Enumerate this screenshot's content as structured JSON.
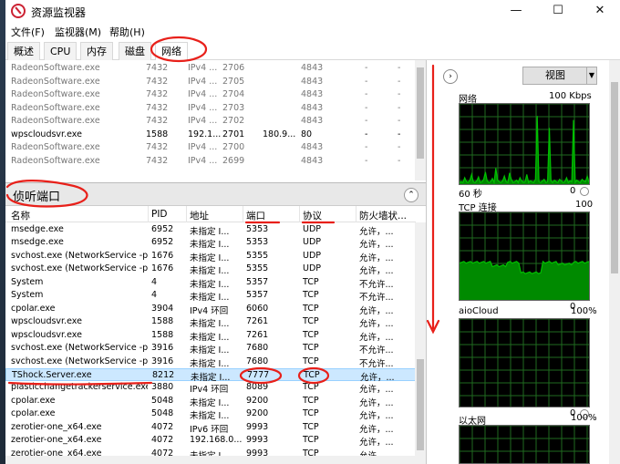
{
  "window": {
    "title": "资源监视器",
    "minimize_glyph": "—",
    "maximize_glyph": "☐",
    "close_glyph": "✕"
  },
  "menu": [
    "文件(F)",
    "监视器(M)",
    "帮助(H)"
  ],
  "tabs": [
    {
      "label": "概述",
      "active": false
    },
    {
      "label": "CPU",
      "active": false
    },
    {
      "label": "内存",
      "active": false
    },
    {
      "label": "磁盘",
      "active": false
    },
    {
      "label": "网络",
      "active": true
    }
  ],
  "upper_rows": [
    [
      "RadeonSoftware.exe",
      "7432",
      "IPv4 ...",
      "2706",
      "",
      "4843",
      "-",
      "-"
    ],
    [
      "RadeonSoftware.exe",
      "7432",
      "IPv4 ...",
      "2705",
      "",
      "4843",
      "-",
      "-"
    ],
    [
      "RadeonSoftware.exe",
      "7432",
      "IPv4 ...",
      "2704",
      "",
      "4843",
      "-",
      "-"
    ],
    [
      "RadeonSoftware.exe",
      "7432",
      "IPv4 ...",
      "2703",
      "",
      "4843",
      "-",
      "-"
    ],
    [
      "RadeonSoftware.exe",
      "7432",
      "IPv4 ...",
      "2702",
      "",
      "4843",
      "-",
      "-"
    ],
    [
      "wpscloudsvr.exe",
      "1588",
      "192.1...",
      "2701",
      "180.9...",
      "80",
      "-",
      "-"
    ],
    [
      "RadeonSoftware.exe",
      "7432",
      "IPv4 ...",
      "2700",
      "",
      "4843",
      "-",
      "-"
    ],
    [
      "RadeonSoftware.exe",
      "7432",
      "IPv4 ...",
      "2699",
      "",
      "4843",
      "-",
      "-"
    ]
  ],
  "listening": {
    "title": "侦听端口",
    "collapse_glyph": "⌃",
    "columns": [
      "名称",
      "PID",
      "地址",
      "端口",
      "协议",
      "防火墙状..."
    ],
    "rows": [
      [
        "msedge.exe",
        "6952",
        "未指定 I...",
        "5353",
        "UDP",
        "允许，..."
      ],
      [
        "msedge.exe",
        "6952",
        "未指定 I...",
        "5353",
        "UDP",
        "允许，..."
      ],
      [
        "svchost.exe (NetworkService -p)",
        "1676",
        "未指定 I...",
        "5355",
        "UDP",
        "允许，..."
      ],
      [
        "svchost.exe (NetworkService -p)",
        "1676",
        "未指定 I...",
        "5355",
        "UDP",
        "允许，..."
      ],
      [
        "System",
        "4",
        "未指定 I...",
        "5357",
        "TCP",
        "不允许..."
      ],
      [
        "System",
        "4",
        "未指定 I...",
        "5357",
        "TCP",
        "不允许..."
      ],
      [
        "cpolar.exe",
        "3904",
        "IPv4 环回",
        "6060",
        "TCP",
        "允许，..."
      ],
      [
        "wpscloudsvr.exe",
        "1588",
        "未指定 I...",
        "7261",
        "TCP",
        "允许，..."
      ],
      [
        "wpscloudsvr.exe",
        "1588",
        "未指定 I...",
        "7261",
        "TCP",
        "允许，..."
      ],
      [
        "svchost.exe (NetworkService -p)",
        "3916",
        "未指定 I...",
        "7680",
        "TCP",
        "不允许..."
      ],
      [
        "svchost.exe (NetworkService -p)",
        "3916",
        "未指定 I...",
        "7680",
        "TCP",
        "不允许..."
      ],
      [
        "TShock.Server.exe",
        "8212",
        "未指定 I...",
        "7777",
        "TCP",
        "允许，..."
      ],
      [
        "plasticchangetrackerservice.exe",
        "3880",
        "IPv4 环回",
        "8089",
        "TCP",
        "允许，..."
      ],
      [
        "cpolar.exe",
        "5048",
        "未指定 I...",
        "9200",
        "TCP",
        "允许，..."
      ],
      [
        "cpolar.exe",
        "5048",
        "未指定 I...",
        "9200",
        "TCP",
        "允许，..."
      ],
      [
        "zerotier-one_x64.exe",
        "4072",
        "IPv6 环回",
        "9993",
        "TCP",
        "允许，..."
      ],
      [
        "zerotier-one_x64.exe",
        "4072",
        "192.168.0...",
        "9993",
        "TCP",
        "允许，..."
      ],
      [
        "zerotier-one_x64.exe",
        "4072",
        "未指定 I...",
        "9993",
        "TCP",
        "允许，..."
      ]
    ],
    "selected_index": 11
  },
  "right_pane": {
    "expand_glyph": "›",
    "view_label": "视图",
    "view_arrow": "▼",
    "graphs": [
      {
        "title": "网络",
        "scale": "100 Kbps",
        "caption_left": "60 秒",
        "caption_right": "0"
      },
      {
        "title": "TCP 连接",
        "scale": "100",
        "caption_left": "",
        "caption_right": "0"
      },
      {
        "title": "aioCloud",
        "scale": "100%",
        "caption_left": "",
        "caption_right": "0"
      },
      {
        "title": "以太网",
        "scale": "100%",
        "caption_left": "",
        "caption_right": ""
      }
    ],
    "net_series": [
      2,
      3,
      2,
      8,
      3,
      2,
      5,
      12,
      3,
      2,
      4,
      9,
      2,
      3,
      6,
      15,
      4,
      2,
      3,
      7,
      2,
      20,
      5,
      3,
      2,
      4,
      10,
      3,
      2,
      14,
      6,
      2,
      3,
      5,
      2,
      8,
      4,
      2,
      3,
      12,
      2,
      4,
      3,
      2,
      6,
      85,
      3,
      2,
      4,
      6,
      2,
      3,
      70,
      4,
      2,
      5,
      3,
      2,
      6,
      4,
      2,
      3,
      8,
      2,
      4,
      3,
      80,
      2,
      5,
      3,
      2,
      6,
      4,
      3,
      10,
      2
    ]
  },
  "colors": {
    "graph_bg": "#000000",
    "graph_line": "#00c000",
    "graph_fill": "#008a00",
    "grid": "#1f6a1f",
    "annotation": "#e8201a",
    "selected_row": "#cce8ff"
  }
}
